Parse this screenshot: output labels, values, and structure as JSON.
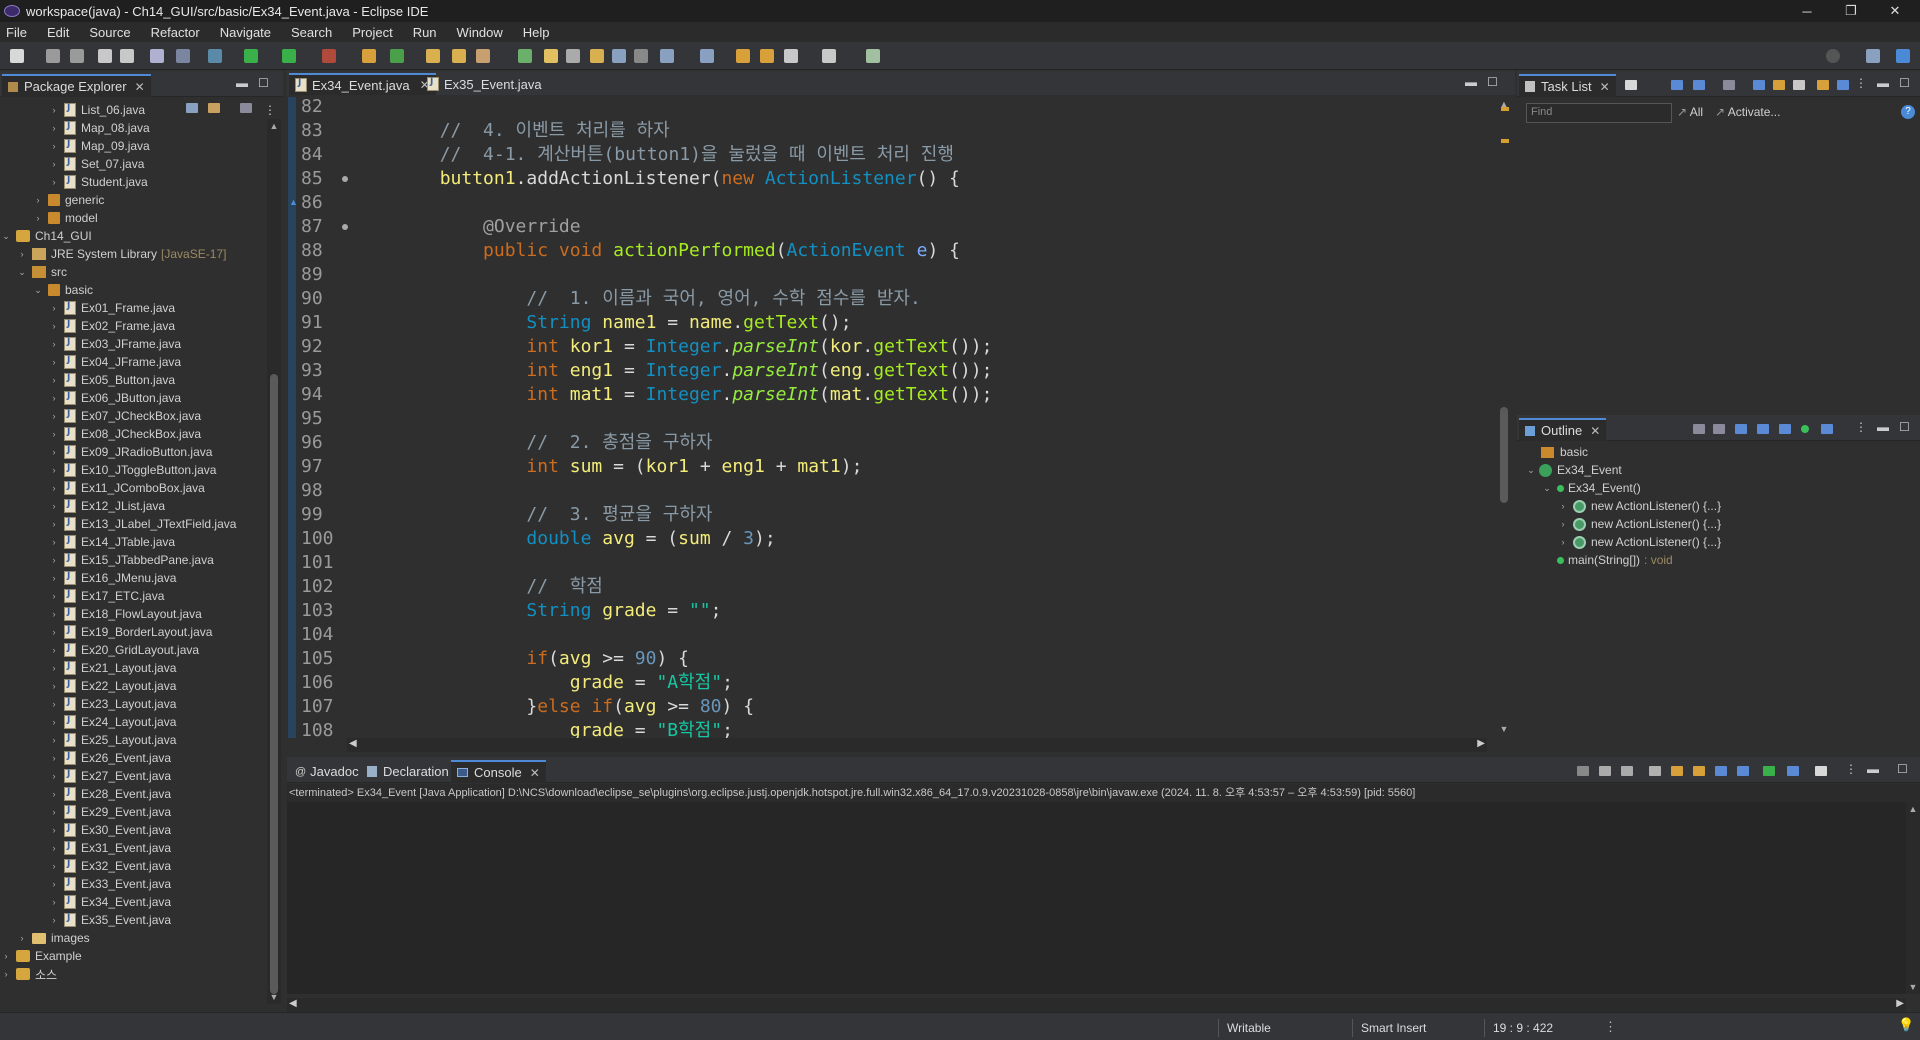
{
  "window": {
    "title": "workspace(java) - Ch14_GUI/src/basic/Ex34_Event.java - Eclipse IDE",
    "controls": [
      "─",
      "❐",
      "✕"
    ]
  },
  "menu": [
    "File",
    "Edit",
    "Source",
    "Refactor",
    "Navigate",
    "Search",
    "Project",
    "Run",
    "Window",
    "Help"
  ],
  "package_explorer": {
    "tab": "Package Explorer",
    "items": [
      {
        "label": "List_06.java",
        "kind": "file",
        "indent": 3
      },
      {
        "label": "Map_08.java",
        "kind": "file",
        "indent": 3
      },
      {
        "label": "Map_09.java",
        "kind": "file",
        "indent": 3
      },
      {
        "label": "Set_07.java",
        "kind": "file",
        "indent": 3
      },
      {
        "label": "Student.java",
        "kind": "file",
        "indent": 3
      },
      {
        "label": "generic",
        "kind": "package",
        "indent": 2
      },
      {
        "label": "model",
        "kind": "package",
        "indent": 2
      },
      {
        "label": "Ch14_GUI",
        "kind": "project",
        "indent": 0,
        "expanded": true
      },
      {
        "label": "JRE System Library",
        "decor": "[JavaSE-17]",
        "kind": "library",
        "indent": 1
      },
      {
        "label": "src",
        "kind": "src",
        "indent": 1,
        "expanded": true
      },
      {
        "label": "basic",
        "kind": "package",
        "indent": 2,
        "expanded": true
      },
      {
        "label": "Ex01_Frame.java",
        "kind": "file",
        "indent": 3
      },
      {
        "label": "Ex02_Frame.java",
        "kind": "file",
        "indent": 3
      },
      {
        "label": "Ex03_JFrame.java",
        "kind": "file",
        "indent": 3
      },
      {
        "label": "Ex04_JFrame.java",
        "kind": "file",
        "indent": 3
      },
      {
        "label": "Ex05_Button.java",
        "kind": "file",
        "indent": 3
      },
      {
        "label": "Ex06_JButton.java",
        "kind": "file",
        "indent": 3
      },
      {
        "label": "Ex07_JCheckBox.java",
        "kind": "file",
        "indent": 3
      },
      {
        "label": "Ex08_JCheckBox.java",
        "kind": "file",
        "indent": 3
      },
      {
        "label": "Ex09_JRadioButton.java",
        "kind": "file",
        "indent": 3
      },
      {
        "label": "Ex10_JToggleButton.java",
        "kind": "file",
        "indent": 3
      },
      {
        "label": "Ex11_JComboBox.java",
        "kind": "file",
        "indent": 3
      },
      {
        "label": "Ex12_JList.java",
        "kind": "file",
        "indent": 3
      },
      {
        "label": "Ex13_JLabel_JTextField.java",
        "kind": "file",
        "indent": 3
      },
      {
        "label": "Ex14_JTable.java",
        "kind": "file",
        "indent": 3
      },
      {
        "label": "Ex15_JTabbedPane.java",
        "kind": "file",
        "indent": 3
      },
      {
        "label": "Ex16_JMenu.java",
        "kind": "file",
        "indent": 3
      },
      {
        "label": "Ex17_ETC.java",
        "kind": "file",
        "indent": 3
      },
      {
        "label": "Ex18_FlowLayout.java",
        "kind": "file",
        "indent": 3
      },
      {
        "label": "Ex19_BorderLayout.java",
        "kind": "file",
        "indent": 3
      },
      {
        "label": "Ex20_GridLayout.java",
        "kind": "file",
        "indent": 3
      },
      {
        "label": "Ex21_Layout.java",
        "kind": "file",
        "indent": 3
      },
      {
        "label": "Ex22_Layout.java",
        "kind": "file",
        "indent": 3
      },
      {
        "label": "Ex23_Layout.java",
        "kind": "file",
        "indent": 3
      },
      {
        "label": "Ex24_Layout.java",
        "kind": "file",
        "indent": 3
      },
      {
        "label": "Ex25_Layout.java",
        "kind": "file",
        "indent": 3
      },
      {
        "label": "Ex26_Event.java",
        "kind": "file",
        "indent": 3
      },
      {
        "label": "Ex27_Event.java",
        "kind": "file",
        "indent": 3
      },
      {
        "label": "Ex28_Event.java",
        "kind": "file",
        "indent": 3
      },
      {
        "label": "Ex29_Event.java",
        "kind": "file",
        "indent": 3
      },
      {
        "label": "Ex30_Event.java",
        "kind": "file",
        "indent": 3
      },
      {
        "label": "Ex31_Event.java",
        "kind": "file",
        "indent": 3
      },
      {
        "label": "Ex32_Event.java",
        "kind": "file",
        "indent": 3
      },
      {
        "label": "Ex33_Event.java",
        "kind": "file",
        "indent": 3
      },
      {
        "label": "Ex34_Event.java",
        "kind": "file",
        "indent": 3
      },
      {
        "label": "Ex35_Event.java",
        "kind": "file",
        "indent": 3
      },
      {
        "label": "images",
        "kind": "folder",
        "indent": 1
      },
      {
        "label": "Example",
        "kind": "project",
        "indent": 0
      },
      {
        "label": "소스",
        "kind": "project",
        "indent": 0
      }
    ]
  },
  "editor": {
    "tabs": [
      {
        "label": "Ex34_Event.java",
        "active": true
      },
      {
        "label": "Ex35_Event.java",
        "active": false
      }
    ],
    "lines": [
      {
        "num": "82",
        "fold": false,
        "html": ""
      },
      {
        "num": "83",
        "fold": false,
        "html": "        <span class='c-com'>//  4. 이벤트 처리를 하자</span>"
      },
      {
        "num": "84",
        "fold": false,
        "html": "        <span class='c-com'>//  4-1. 계산버튼(button1)을 눌렀을 때 이벤트 처리 진행</span>"
      },
      {
        "num": "85",
        "fold": true,
        "html": "        <span class='c-var'>button1</span>.addActionListener(<span class='c-kw'>new</span> <span class='c-type'>ActionListener</span>() {"
      },
      {
        "num": "86",
        "fold": false,
        "html": ""
      },
      {
        "num": "87",
        "fold": true,
        "html": "            <span class='c-ann'>@Override</span>"
      },
      {
        "num": "88",
        "fold": false,
        "html": "            <span class='c-kw'>public</span> <span class='c-kw'>void</span> <span class='c-fn'>actionPerformed</span>(<span class='c-type'>ActionEvent</span> <span class='c-param'>e</span>) {"
      },
      {
        "num": "89",
        "fold": false,
        "html": ""
      },
      {
        "num": "90",
        "fold": false,
        "html": "                <span class='c-com'>//  1. 이름과 국어, 영어, 수학 점수를 받자.</span>"
      },
      {
        "num": "91",
        "fold": false,
        "html": "                <span class='c-type'>String</span> <span class='c-var'>name1</span> = <span class='c-var'>name</span>.<span class='c-fn'>getText</span>();"
      },
      {
        "num": "92",
        "fold": false,
        "html": "                <span class='c-kw'>int</span> <span class='c-var'>kor1</span> = <span class='c-type'>Integer</span>.<span class='c-static'>parseInt</span>(<span class='c-var'>kor</span>.<span class='c-fn'>getText</span>());"
      },
      {
        "num": "93",
        "fold": false,
        "html": "                <span class='c-kw'>int</span> <span class='c-var'>eng1</span> = <span class='c-type'>Integer</span>.<span class='c-static'>parseInt</span>(<span class='c-var'>eng</span>.<span class='c-fn'>getText</span>());"
      },
      {
        "num": "94",
        "fold": false,
        "html": "                <span class='c-kw'>int</span> <span class='c-var'>mat1</span> = <span class='c-type'>Integer</span>.<span class='c-static'>parseInt</span>(<span class='c-var'>mat</span>.<span class='c-fn'>getText</span>());"
      },
      {
        "num": "95",
        "fold": false,
        "html": ""
      },
      {
        "num": "96",
        "fold": false,
        "html": "                <span class='c-com'>//  2. 총점을 구하자</span>"
      },
      {
        "num": "97",
        "fold": false,
        "html": "                <span class='c-kw'>int</span> <span class='c-var'>sum</span> = (<span class='c-var'>kor1</span> + <span class='c-var'>eng1</span> + <span class='c-var'>mat1</span>);"
      },
      {
        "num": "98",
        "fold": false,
        "html": ""
      },
      {
        "num": "99",
        "fold": false,
        "html": "                <span class='c-com'>//  3. 평균을 구하자</span>"
      },
      {
        "num": "100",
        "fold": false,
        "html": "                <span class='c-type'>double</span> <span class='c-var'>avg</span> = (<span class='c-var'>sum</span> / <span class='c-num'>3</span>);"
      },
      {
        "num": "101",
        "fold": false,
        "html": ""
      },
      {
        "num": "102",
        "fold": false,
        "html": "                <span class='c-com'>//  학점</span>"
      },
      {
        "num": "103",
        "fold": false,
        "html": "                <span class='c-type'>String</span> <span class='c-var'>grade</span> = <span class='c-str'>\"\"</span>;"
      },
      {
        "num": "104",
        "fold": false,
        "html": ""
      },
      {
        "num": "105",
        "fold": false,
        "html": "                <span class='c-kw'>if</span>(<span class='c-var'>avg</span> >= <span class='c-num'>90</span>) {"
      },
      {
        "num": "106",
        "fold": false,
        "html": "                    <span class='c-var'>grade</span> = <span class='c-str'>\"A학점\"</span>;"
      },
      {
        "num": "107",
        "fold": false,
        "html": "                }<span class='c-kw'>else</span> <span class='c-kw'>if</span>(<span class='c-var'>avg</span> >= <span class='c-num'>80</span>) {"
      },
      {
        "num": "108",
        "fold": false,
        "html": "                    <span class='c-var'>grade</span> = <span class='c-str'>\"B학점\"</span>;"
      }
    ]
  },
  "task_list": {
    "tab": "Task List",
    "find_placeholder": "Find",
    "all_label": "All",
    "activate_label": "Activate..."
  },
  "outline": {
    "tab": "Outline",
    "items": [
      {
        "label": "basic",
        "suffix": "",
        "kind": "package",
        "indent": 0,
        "arrow": ""
      },
      {
        "label": "Ex34_Event",
        "suffix": "",
        "kind": "class",
        "indent": 0,
        "arrow": "v"
      },
      {
        "label": "Ex34_Event()",
        "suffix": "",
        "kind": "constructor",
        "indent": 1,
        "arrow": "v"
      },
      {
        "label": "new ActionListener() {...}",
        "suffix": "",
        "kind": "anon",
        "indent": 2,
        "arrow": ">"
      },
      {
        "label": "new ActionListener() {...}",
        "suffix": "",
        "kind": "anon",
        "indent": 2,
        "arrow": ">"
      },
      {
        "label": "new ActionListener() {...}",
        "suffix": "",
        "kind": "anon",
        "indent": 2,
        "arrow": ">"
      },
      {
        "label": "main(String[])",
        "suffix": ": void",
        "kind": "method",
        "indent": 1,
        "arrow": ""
      }
    ]
  },
  "bottom": {
    "tabs": [
      "Javadoc",
      "Declaration",
      "Console"
    ],
    "active_tab": "Console",
    "console_info": "<terminated> Ex34_Event [Java Application] D:\\NCS\\download\\eclipse_se\\plugins\\org.eclipse.justj.openjdk.hotspot.jre.full.win32.x86_64_17.0.9.v20231028-0858\\jre\\bin\\javaw.exe  (2024. 11. 8. 오후 4:53:57 – 오후 4:53:59) [pid: 5560]"
  },
  "status": {
    "writable": "Writable",
    "insert_mode": "Smart Insert",
    "position": "19 : 9 : 422"
  },
  "colors": {
    "accent": "#4e8ad6",
    "background": "#2f2f2f",
    "keyword": "#cc6c1d",
    "type": "#1290c3",
    "comment": "#8a9aa6"
  }
}
